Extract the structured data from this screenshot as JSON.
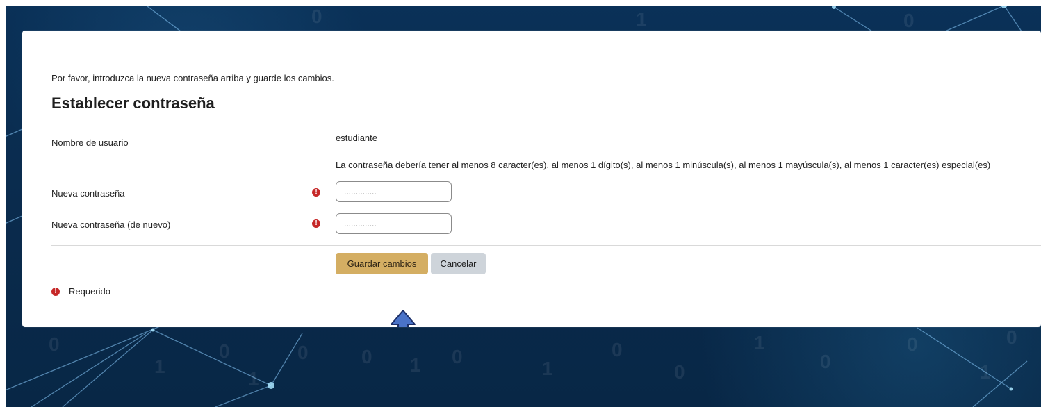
{
  "theme": {
    "page_bg": "#0c2f52",
    "card_bg": "#ffffff",
    "primary_button_bg": "#d4ae63",
    "secondary_button_bg": "#ced4da",
    "required_icon_color": "#c62828",
    "arrow_fill": "#4a73c8",
    "arrow_stroke": "#1c2f68"
  },
  "form": {
    "intro_text": "Por favor, introduzca la nueva contraseña arriba y guarde los cambios.",
    "title": "Establecer contraseña",
    "username_label": "Nombre de usuario",
    "username_value": "estudiante",
    "password_rules": "La contraseña debería tener al menos 8 caracter(es), al menos 1 dígito(s), al menos 1 minúscula(s), al menos 1 mayúscula(s), al menos 1 caracter(es) especial(es)",
    "new_password_label": "Nueva contraseña",
    "new_password_value": "..............",
    "repeat_password_label": "Nueva contraseña (de nuevo)",
    "repeat_password_value": "..............",
    "save_button_label": "Guardar cambios",
    "cancel_button_label": "Cancelar",
    "required_label": "Requerido",
    "required_icon_glyph": "!"
  },
  "icons": {
    "required": "required-icon",
    "arrow": "up-arrow-icon"
  },
  "background": {
    "digits": [
      "0",
      "1",
      "0",
      "1",
      "0",
      "0",
      "1",
      "0",
      "1",
      "0",
      "0",
      "1",
      "0",
      "0",
      "1",
      "0",
      "0",
      "1",
      "0"
    ]
  }
}
